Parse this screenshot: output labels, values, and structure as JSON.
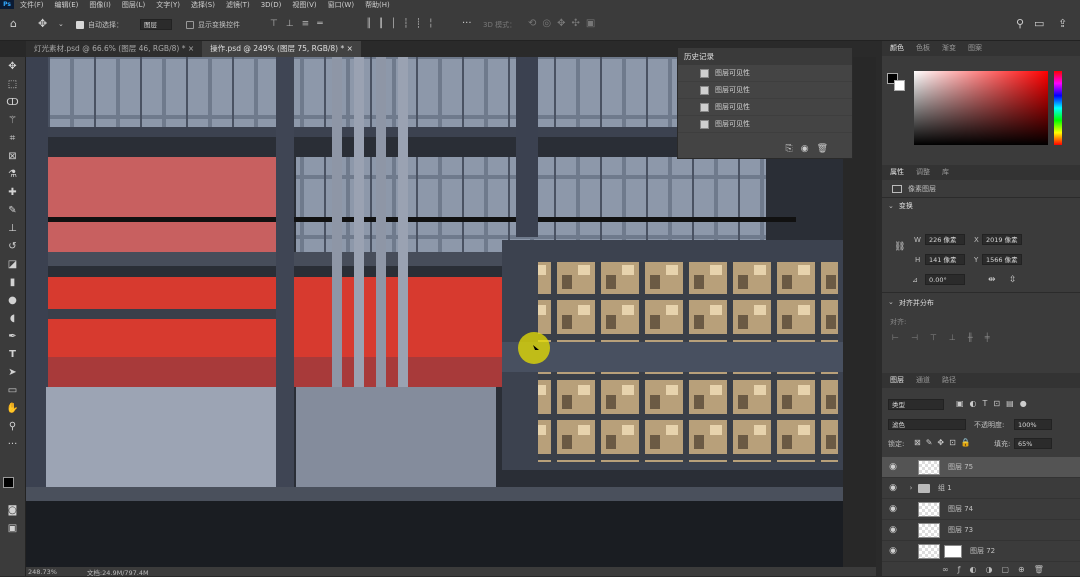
{
  "app": {
    "logo": "Ps"
  },
  "menu": [
    "文件(F)",
    "编辑(E)",
    "图像(I)",
    "图层(L)",
    "文字(Y)",
    "选择(S)",
    "滤镜(T)",
    "3D(D)",
    "视图(V)",
    "窗口(W)",
    "帮助(H)"
  ],
  "options": {
    "auto_select_label": "自动选择：",
    "auto_select_value": "图层",
    "transform_label": "显示变换控件",
    "mode_3d": "3D 模式："
  },
  "tabs": [
    {
      "label": "灯光素材.psd @ 66.6% (图层 46, RGB/8) *",
      "active": false
    },
    {
      "label": "操作.psd @ 249% (图层 75, RGB/8) *",
      "active": true
    }
  ],
  "history": {
    "title": "历史记录",
    "items": [
      "图层可见性",
      "图层可见性",
      "图层可见性",
      "图层可见性"
    ]
  },
  "color_panel": {
    "tabs": [
      "颜色",
      "色板",
      "渐变",
      "图案"
    ],
    "active_hue": "#ff0000"
  },
  "properties": {
    "tabs": [
      "属性",
      "调整",
      "库"
    ],
    "layer_type": "像素图层",
    "transform_title": "变换",
    "w_label": "W",
    "w_value": "226 像素",
    "x_label": "X",
    "x_value": "2019 像素",
    "h_label": "H",
    "h_value": "141 像素",
    "y_label": "Y",
    "y_value": "1566 像素",
    "angle_value": "0.00°",
    "align_title": "对齐并分布",
    "align_label": "对齐:"
  },
  "layers": {
    "tabs": [
      "图层",
      "通道",
      "路径"
    ],
    "filter_label": "类型",
    "blend_mode": "滤色",
    "opacity_label": "不透明度:",
    "opacity_value": "100%",
    "lock_label": "锁定:",
    "fill_label": "填充:",
    "fill_value": "65%",
    "items": [
      {
        "name": "图层 75",
        "selected": true
      },
      {
        "name": "组 1",
        "group": true
      },
      {
        "name": "图层 74"
      },
      {
        "name": "图层 73"
      },
      {
        "name": "图层 72",
        "mask": true
      }
    ]
  },
  "status": {
    "zoom": "248.73%",
    "doc": "文档:24.9M/797.4M"
  }
}
